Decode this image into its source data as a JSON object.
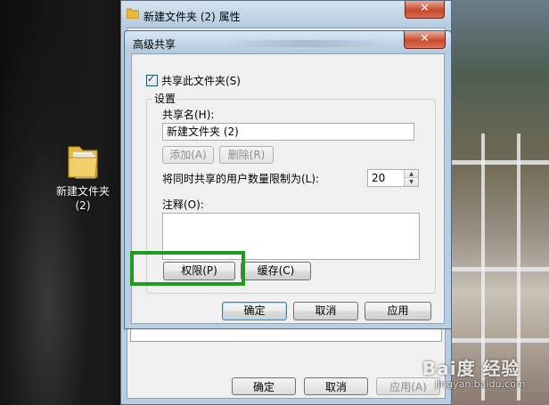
{
  "desktop": {
    "folder_icon": {
      "label_line1": "新建文件夹",
      "label_line2": "(2)",
      "icon": "folder-icon"
    }
  },
  "properties_window": {
    "title": "新建文件夹 (2) 属性",
    "close_glyph": "✕",
    "buttons": {
      "ok": "确定",
      "cancel": "取消",
      "apply": "应用(A)"
    }
  },
  "advanced_sharing": {
    "title": "高级共享",
    "close_glyph": "✕",
    "share_checkbox": {
      "label": "共享此文件夹(S)",
      "checked": true
    },
    "settings_group": "设置",
    "share_name_label": "共享名(H):",
    "share_name_value": "新建文件夹 (2)",
    "add_button": "添加(A)",
    "remove_button": "删除(R)",
    "limit_label": "将同时共享的用户数量限制为(L):",
    "limit_value": "20",
    "comment_label": "注释(O):",
    "comment_value": "",
    "permissions_button": "权限(P)",
    "caching_button": "缓存(C)",
    "ok_button": "确定",
    "cancel_button": "取消",
    "apply_button": "应用"
  },
  "highlight_color": "#1e9c1e",
  "watermark": {
    "brand": "Bai度 经验",
    "url": "jingyan.baidu.com"
  }
}
